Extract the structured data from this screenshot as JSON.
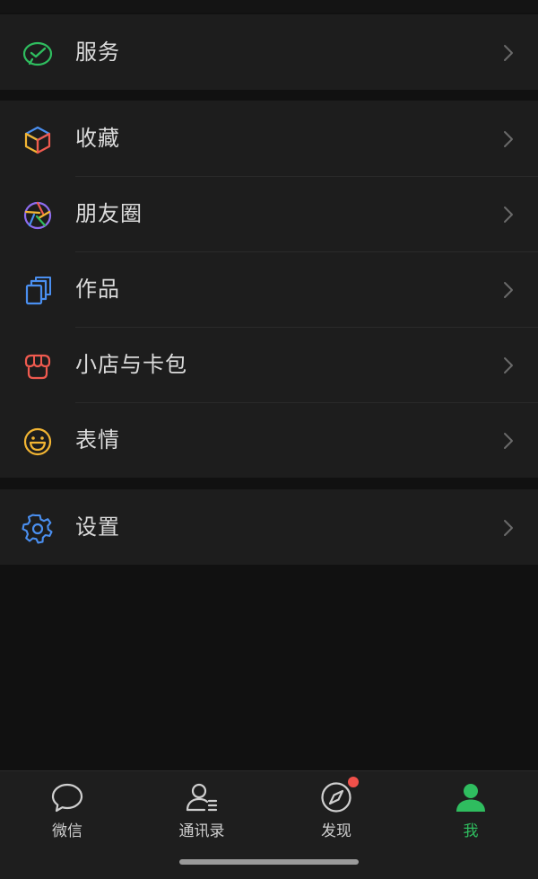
{
  "menu": {
    "services": {
      "label": "服务",
      "icon": "wechat-pay-icon"
    },
    "items": [
      {
        "label": "收藏",
        "icon": "favorites-cube-icon"
      },
      {
        "label": "朋友圈",
        "icon": "moments-aperture-icon"
      },
      {
        "label": "作品",
        "icon": "works-cards-icon"
      },
      {
        "label": "小店与卡包",
        "icon": "shop-awning-icon"
      },
      {
        "label": "表情",
        "icon": "smiley-icon"
      }
    ],
    "settings": {
      "label": "设置",
      "icon": "gear-icon"
    }
  },
  "tabbar": {
    "tabs": [
      {
        "label": "微信",
        "icon": "chat-bubble-icon",
        "active": false
      },
      {
        "label": "通讯录",
        "icon": "contacts-icon",
        "active": false
      },
      {
        "label": "发现",
        "icon": "compass-icon",
        "active": false,
        "badge": "dot"
      },
      {
        "label": "我",
        "icon": "person-icon",
        "active": true
      }
    ]
  },
  "colors": {
    "background": "#111111",
    "card": "#1d1d1d",
    "accent_green": "#2fbd5f",
    "badge_red": "#f0504a"
  }
}
